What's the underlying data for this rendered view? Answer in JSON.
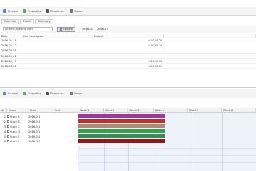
{
  "toolbar": {
    "items": [
      {
        "label": "Preview",
        "icon": "preview-icon"
      },
      {
        "label": "Properties",
        "icon": "properties-icon"
      },
      {
        "label": "Resources",
        "icon": "resources-icon"
      },
      {
        "label": "Report",
        "icon": "report-icon"
      }
    ]
  },
  "subtabs": [
    "Overview",
    "Details",
    "Summary"
  ],
  "filter": {
    "scope": "All time, starting with",
    "update_label": "Update",
    "range_start": "2016-01",
    "range_end": "2016-12"
  },
  "upper_table": {
    "headers": [
      "Date",
      "Item description",
      "Budget",
      ""
    ],
    "rows": [
      [
        "2016-01-15",
        "",
        "",
        "0.00 / 0.00"
      ],
      [
        "2016-01-22",
        "",
        "",
        "0.00 / 0.00"
      ],
      [
        "2016-02-01",
        "",
        "",
        ""
      ],
      [
        "2016-02-08",
        "",
        "",
        ""
      ],
      [
        "2016-02-15",
        "",
        "",
        "0.00 / 0.00"
      ],
      [
        "2016-03-01",
        "",
        "",
        "0.00 / 0.00"
      ]
    ]
  },
  "toolbar2": {
    "items": [
      {
        "label": "Preview",
        "icon": "preview-icon"
      },
      {
        "label": "Properties",
        "icon": "properties-icon"
      },
      {
        "label": "Resources",
        "icon": "resources-icon"
      },
      {
        "label": "Report",
        "icon": "report-icon"
      }
    ]
  },
  "lower_grid": {
    "headers": [
      "#",
      "Name",
      "Start",
      "End",
      "Week 1",
      "Week 2",
      "Week 3",
      "Week 4",
      "Week 5",
      "Week 6"
    ],
    "rows": [
      {
        "num": "1",
        "name": "Stock A",
        "id": "2016-0-1",
        "color": "#9b3c8e"
      },
      {
        "num": "2",
        "name": "Stock B",
        "id": "2016-0-1",
        "color": "#b8342a"
      },
      {
        "num": "3",
        "name": "Stock C",
        "id": "2016-0-1",
        "color": "#a88d7a"
      },
      {
        "num": "4",
        "name": "Stock D",
        "id": "2016-0-1",
        "color": "#3f9a55"
      },
      {
        "num": "5",
        "name": "Stock E",
        "id": "2016-0-1",
        "color": "#3b8b5a"
      },
      {
        "num": "6",
        "name": "Stock F",
        "id": "2016-0-1",
        "color": "#8b1a1a"
      }
    ]
  }
}
